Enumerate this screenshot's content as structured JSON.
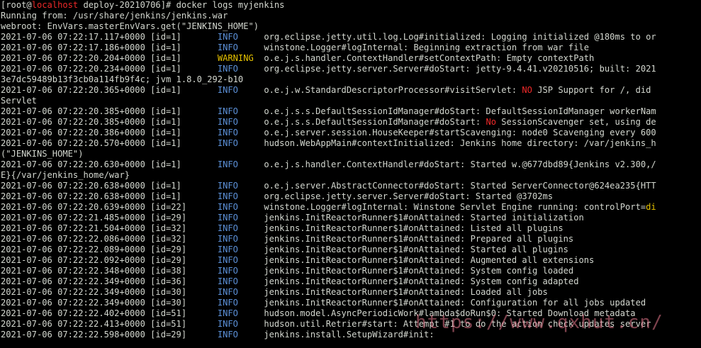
{
  "terminal": {
    "prompt": {
      "open": "[root@",
      "host": "localhost",
      "rest": " deploy-20210706]# ",
      "command": "docker logs myjenkins"
    },
    "preamble": [
      "Running from: /usr/share/jenkins/jenkins.war",
      "webroot: EnvVars.masterEnvVars.get(\"JENKINS_HOME\")"
    ],
    "log": [
      {
        "ts": "2021-07-06 07:22:17.117+0000 [id=1]",
        "level": "INFO",
        "msg": "org.eclipse.jetty.util.log.Log#initialized: Logging initialized @180ms to or"
      },
      {
        "ts": "2021-07-06 07:22:17.186+0000 [id=1]",
        "level": "INFO",
        "msg": "winstone.Logger#logInternal: Beginning extraction from war file"
      },
      {
        "ts": "2021-07-06 07:22:20.204+0000 [id=1]",
        "level": "WARNING",
        "msg": "o.e.j.s.handler.ContextHandler#setContextPath: Empty contextPath"
      },
      {
        "ts": "2021-07-06 07:22:20.234+0000 [id=1]",
        "level": "INFO",
        "msg": "org.eclipse.jetty.server.Server#doStart: jetty-9.4.41.v20210516; built: 2021"
      },
      {
        "cont": "3e7dc59489b13f3cb0a114fb9f4c; jvm 1.8.0_292-b10"
      },
      {
        "ts": "2021-07-06 07:22:20.365+0000 [id=1]",
        "level": "INFO",
        "msg_pre": "o.e.j.w.StandardDescriptorProcessor#visitServlet: ",
        "msg_hl": "NO",
        "msg_post": " JSP Support for /, did"
      },
      {
        "cont": "Servlet"
      },
      {
        "ts": "2021-07-06 07:22:20.385+0000 [id=1]",
        "level": "INFO",
        "msg": "o.e.j.s.s.DefaultSessionIdManager#doStart: DefaultSessionIdManager workerNam"
      },
      {
        "ts": "2021-07-06 07:22:20.385+0000 [id=1]",
        "level": "INFO",
        "msg_pre": "o.e.j.s.s.DefaultSessionIdManager#doStart: ",
        "msg_hl": "No",
        "msg_post": " SessionScavenger set, using de"
      },
      {
        "ts": "2021-07-06 07:22:20.386+0000 [id=1]",
        "level": "INFO",
        "msg": "o.e.j.server.session.HouseKeeper#startScavenging: node0 Scavenging every 600"
      },
      {
        "ts": "2021-07-06 07:22:20.570+0000 [id=1]",
        "level": "INFO",
        "msg": "hudson.WebAppMain#contextInitialized: Jenkins home directory: /var/jenkins_h"
      },
      {
        "cont": "(\"JENKINS_HOME\")"
      },
      {
        "ts": "2021-07-06 07:22:20.630+0000 [id=1]",
        "level": "INFO",
        "msg": "o.e.j.s.handler.ContextHandler#doStart: Started w.@677dbd89{Jenkins v2.300,/"
      },
      {
        "cont": "E}{/var/jenkins_home/war}"
      },
      {
        "ts": "2021-07-06 07:22:20.638+0000 [id=1]",
        "level": "INFO",
        "msg": "o.e.j.server.AbstractConnector#doStart: Started ServerConnector@624ea235{HTT"
      },
      {
        "ts": "2021-07-06 07:22:20.638+0000 [id=1]",
        "level": "INFO",
        "msg": "org.eclipse.jetty.server.Server#doStart: Started @3702ms"
      },
      {
        "ts": "2021-07-06 07:22:20.639+0000 [id=22]",
        "level": "INFO",
        "msg_pre": "winstone.Logger#logInternal: Winstone Servlet Engine running: controlPort=",
        "msg_yl": "di"
      },
      {
        "ts": "2021-07-06 07:22:21.485+0000 [id=29]",
        "level": "INFO",
        "msg": "jenkins.InitReactorRunner$1#onAttained: Started initialization"
      },
      {
        "ts": "2021-07-06 07:22:21.504+0000 [id=32]",
        "level": "INFO",
        "msg": "jenkins.InitReactorRunner$1#onAttained: Listed all plugins"
      },
      {
        "ts": "2021-07-06 07:22:22.086+0000 [id=32]",
        "level": "INFO",
        "msg": "jenkins.InitReactorRunner$1#onAttained: Prepared all plugins"
      },
      {
        "ts": "2021-07-06 07:22:22.089+0000 [id=29]",
        "level": "INFO",
        "msg": "jenkins.InitReactorRunner$1#onAttained: Started all plugins"
      },
      {
        "ts": "2021-07-06 07:22:22.092+0000 [id=29]",
        "level": "INFO",
        "msg": "jenkins.InitReactorRunner$1#onAttained: Augmented all extensions"
      },
      {
        "ts": "2021-07-06 07:22:22.348+0000 [id=38]",
        "level": "INFO",
        "msg": "jenkins.InitReactorRunner$1#onAttained: System config loaded"
      },
      {
        "ts": "2021-07-06 07:22:22.349+0000 [id=36]",
        "level": "INFO",
        "msg": "jenkins.InitReactorRunner$1#onAttained: System config adapted"
      },
      {
        "ts": "2021-07-06 07:22:22.349+0000 [id=30]",
        "level": "INFO",
        "msg": "jenkins.InitReactorRunner$1#onAttained: Loaded all jobs"
      },
      {
        "ts": "2021-07-06 07:22:22.349+0000 [id=30]",
        "level": "INFO",
        "msg": "jenkins.InitReactorRunner$1#onAttained: Configuration for all jobs updated"
      },
      {
        "ts": "2021-07-06 07:22:22.402+0000 [id=51]",
        "level": "INFO",
        "msg": "hudson.model.AsyncPeriodicWork#lambda$doRun$0: Started Download metadata"
      },
      {
        "ts": "2021-07-06 07:22:22.413+0000 [id=51]",
        "level": "INFO",
        "msg": "hudson.util.Retrier#start: Attempt #1 to do the action check updates server"
      },
      {
        "ts": "2021-07-06 07:22:22.598+0000 [id=29]",
        "level": "INFO",
        "msg": "jenkins.install.SetupWizard#init:"
      }
    ],
    "watermark": "https://www.qxhut.cn/"
  }
}
